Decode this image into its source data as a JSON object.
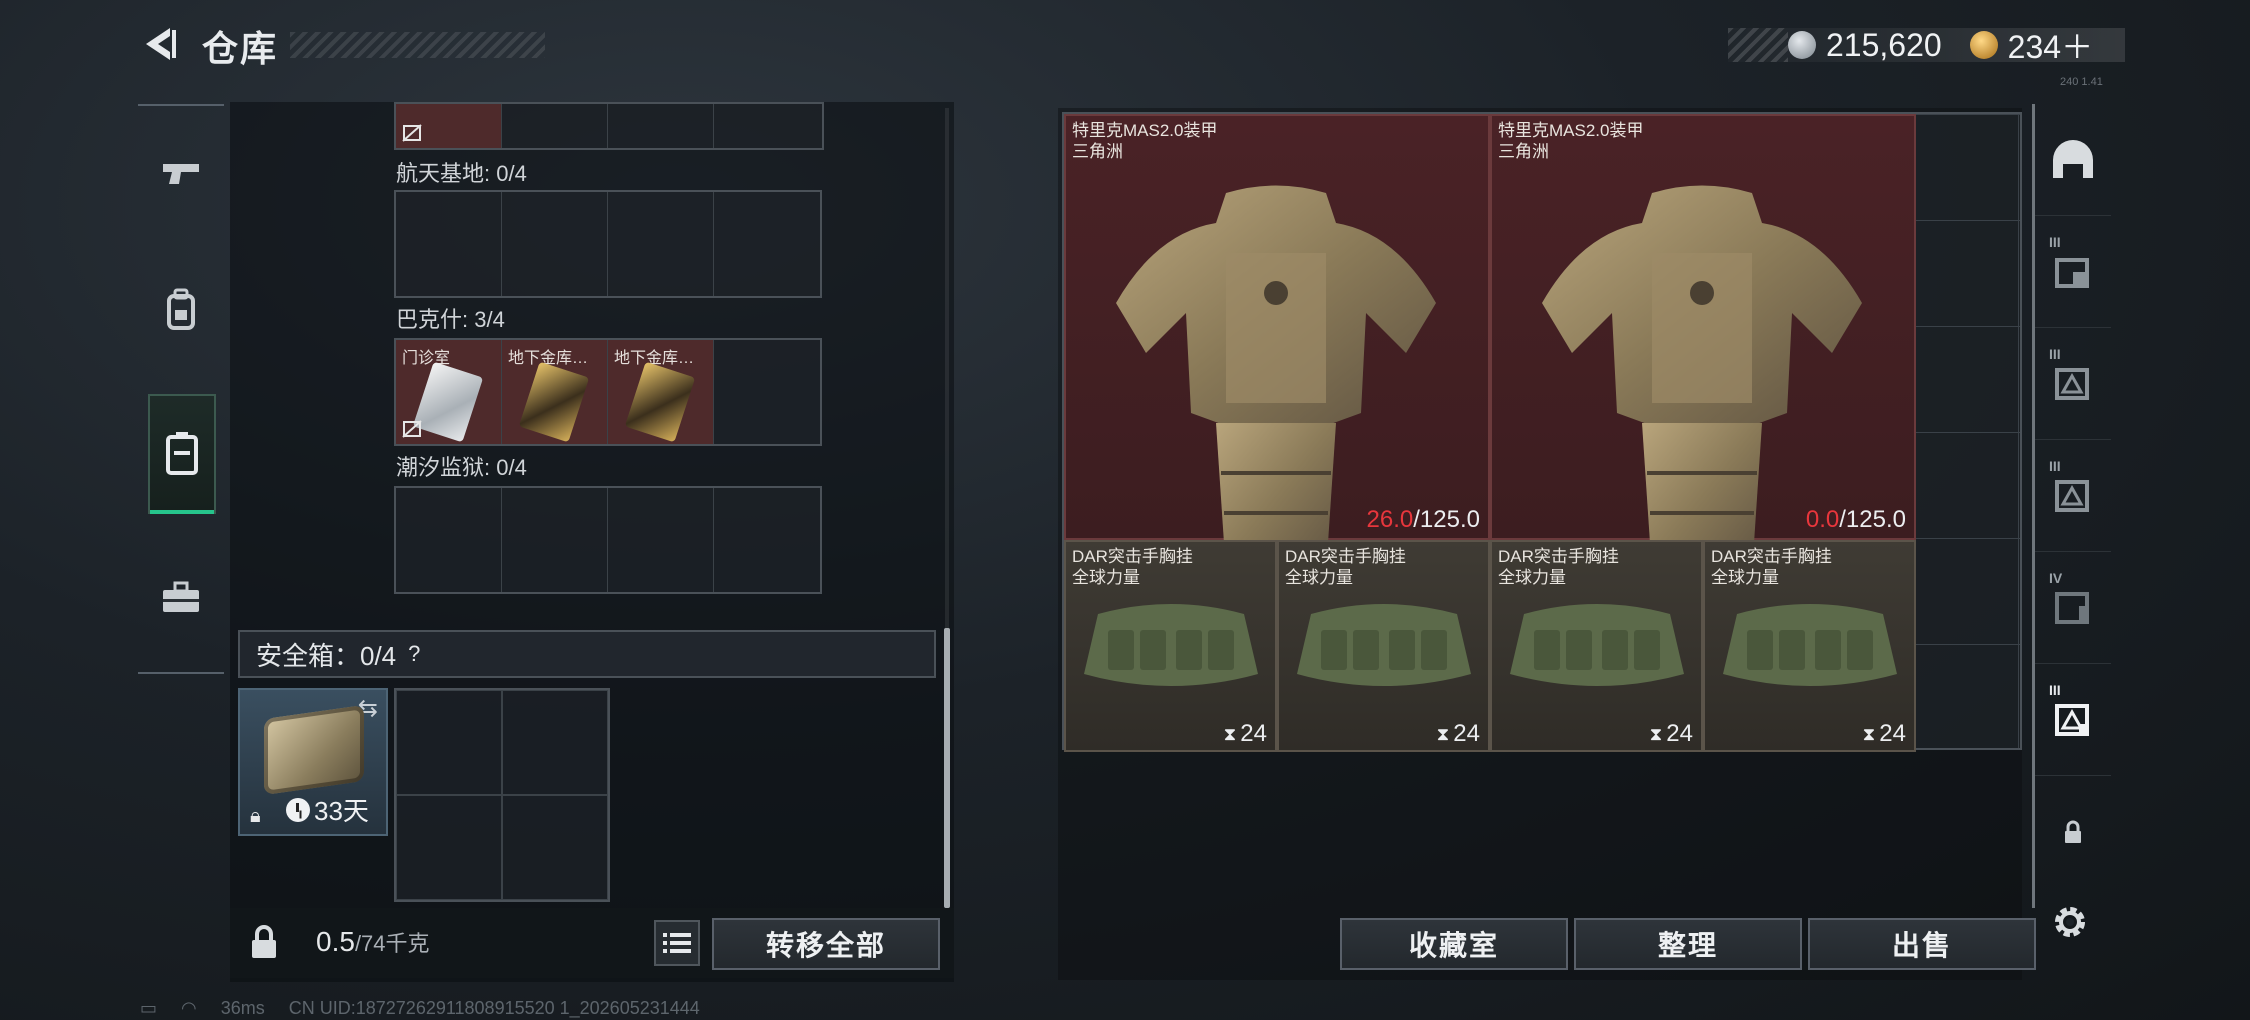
{
  "header": {
    "title": "仓库"
  },
  "currency": {
    "silver": "215,620",
    "gold": "234＋"
  },
  "version_small": "240 1.41",
  "left_nav": [
    "weapon-icon",
    "backpack-icon",
    "container-icon",
    "toolbox-icon"
  ],
  "keycard_sections": [
    {
      "label": "航天基地: 0/4",
      "cards": []
    },
    {
      "label": "巴克什: 3/4",
      "cards": [
        {
          "name": "门诊室",
          "style": "silver"
        },
        {
          "name": "地下金库…",
          "style": "gold"
        },
        {
          "name": "地下金库…",
          "style": "gold"
        }
      ]
    },
    {
      "label": "潮汐监狱: 0/4",
      "cards": []
    }
  ],
  "safebox": {
    "label": "安全箱：0/4",
    "help": "?",
    "days": "33天"
  },
  "weight": {
    "value": "0.5",
    "unit": "/74千克"
  },
  "buttons": {
    "transfer_all": "转移全部",
    "collection": "收藏室",
    "sort": "整理",
    "sell": "出售"
  },
  "stash_items": [
    {
      "name": "特里克MAS2.0装甲",
      "sub": "三角洲",
      "dura_cur": "26.0",
      "dura_max": "/125.0"
    },
    {
      "name": "特里克MAS2.0装甲",
      "sub": "三角洲",
      "dura_cur": "0.0",
      "dura_max": "/125.0"
    },
    {
      "name": "DAR突击手胸挂",
      "sub": "全球力量",
      "count": "24"
    },
    {
      "name": "DAR突击手胸挂",
      "sub": "全球力量",
      "count": "24"
    },
    {
      "name": "DAR突击手胸挂",
      "sub": "全球力量",
      "count": "24"
    },
    {
      "name": "DAR突击手胸挂",
      "sub": "全球力量",
      "count": "24"
    }
  ],
  "right_rail": [
    {
      "icon": "helmet-icon",
      "label": ""
    },
    {
      "icon": "case-tier3-icon",
      "label": "III"
    },
    {
      "icon": "case-tier3b-icon",
      "label": "III"
    },
    {
      "icon": "case-tier3c-icon",
      "label": "III"
    },
    {
      "icon": "case-tier4-icon",
      "label": "IV"
    },
    {
      "icon": "case-tier3d-icon",
      "label": "III"
    },
    {
      "icon": "lock-icon",
      "label": ""
    }
  ],
  "status_bar": {
    "ping": "36ms",
    "uid": "CN UID:18727262911808915520 1_202605231444"
  },
  "colors": {
    "accent": "#26c48c",
    "durability_low": "#e8363c",
    "armor_bg": "#4a2226"
  }
}
